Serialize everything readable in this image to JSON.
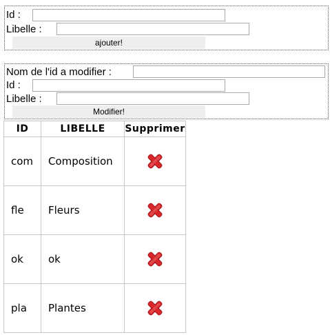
{
  "add_form": {
    "id_label": "Id :",
    "libelle_label": "Libelle :",
    "id_value": "",
    "libelle_value": "",
    "submit_label": "ajouter!"
  },
  "modify_form": {
    "target_label": "Nom de l'id a modifier :",
    "target_value": "",
    "id_label": "Id :",
    "libelle_label": "Libelle :",
    "id_value": "",
    "libelle_value": "",
    "submit_label": "Modifier!"
  },
  "table": {
    "headers": [
      "ID",
      "LIBELLE",
      "Supprimer"
    ],
    "rows": [
      {
        "id": "com",
        "libelle": "Composition",
        "delete_icon": "red-x-delete-icon"
      },
      {
        "id": "fle",
        "libelle": "Fleurs",
        "delete_icon": "red-x-delete-icon"
      },
      {
        "id": "ok",
        "libelle": "ok",
        "delete_icon": "red-x-delete-icon"
      },
      {
        "id": "pla",
        "libelle": "Plantes",
        "delete_icon": "red-x-delete-icon"
      }
    ]
  },
  "colors": {
    "delete_icon": "#d8262b",
    "button_bg": "#eeeeee",
    "table_border": "#c6c6c6"
  }
}
